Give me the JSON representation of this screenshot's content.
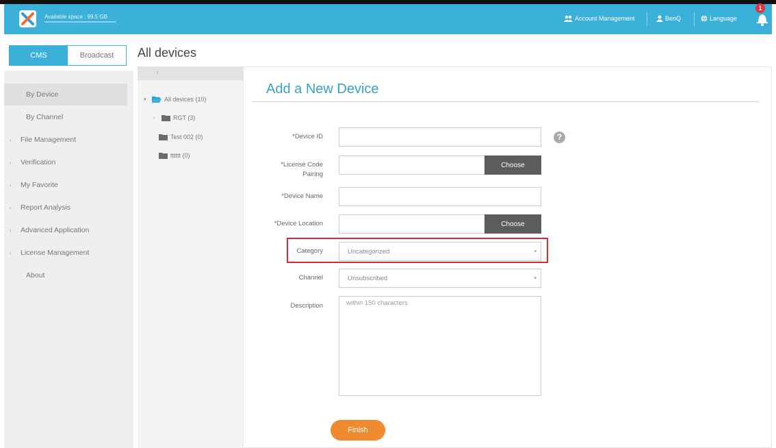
{
  "header": {
    "available_space": "Available space : 99.5 GB",
    "account_management": "Account Management",
    "user": "BenQ",
    "language": "Language",
    "notification_count": "1"
  },
  "mode_toggle": {
    "cms": "CMS",
    "broadcast": "Broadcast"
  },
  "page_title": "All devices",
  "sidebar": {
    "items": [
      {
        "label": "By Device",
        "caret": ""
      },
      {
        "label": "By Channel",
        "caret": ""
      },
      {
        "label": "File Management",
        "caret": "›"
      },
      {
        "label": "Verification",
        "caret": "›"
      },
      {
        "label": "My Favorite",
        "caret": "›"
      },
      {
        "label": "Report Analysis",
        "caret": "›"
      },
      {
        "label": "Advanced Application",
        "caret": "›"
      },
      {
        "label": "License Management",
        "caret": "›"
      },
      {
        "label": "About",
        "caret": ""
      }
    ]
  },
  "tree": {
    "collapse": "‹",
    "root": "All devices (10)",
    "children": [
      {
        "label": "RGT (3)"
      },
      {
        "label": "Test 002 (0)"
      },
      {
        "label": "tttttt (0)"
      }
    ]
  },
  "form": {
    "title": "Add a New Device",
    "device_id_label": "*Device ID",
    "license_label": "*License Code Pairing",
    "device_name_label": "*Device Name",
    "location_label": "*Device Location",
    "category_label": "Category",
    "channel_label": "Channel",
    "description_label": "Description",
    "choose": "Choose",
    "category_value": "Uncategorized",
    "channel_value": "Unsubscribed",
    "description_placeholder": "within 150 characters",
    "help": "?",
    "finish": "Finish"
  },
  "colors": {
    "header": "#3bb0d8",
    "accent": "#3aa0c8",
    "finish": "#ef8a2e",
    "highlight": "#d42a30"
  }
}
